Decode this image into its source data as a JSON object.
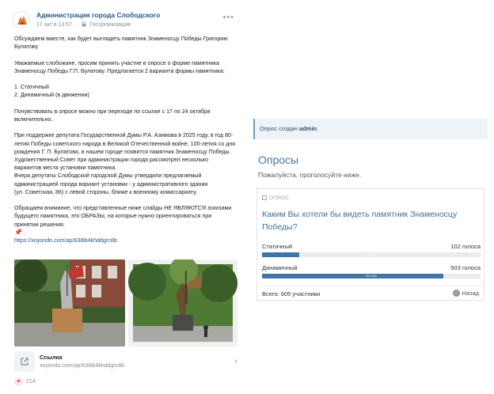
{
  "post": {
    "author": "Администрация города Слободского",
    "date": "17 окт в 13:57",
    "audience": "Госорганизация",
    "paragraphs": [
      "Обсуждаем вместе, как будет выглядеть памятник Знаменосцу Победы Григорию Булатову",
      "Уважаемые слобожане, просим принять участие в опросе о форме памятника Знаменосцу Победы Г.П. Булатову. Предлагается 2 варианта формы памятника:",
      "1. Статичный",
      "2. Динамичный (в движении)",
      "Почувствовать в опросе можно при переходе по ссылке с 17 по 24 октября включительно.",
      "При поддержке депутата Государственной Думы Р.А. Азимова в 2025 году, в год 80-летия Победы советского народа в Великой Отечественной войне, 100-летия со дня рождения Г. П. Булатова, в нашем городе появится памятник Знаменосцу Победы.",
      "Художественный Совет при администрации города рассмотрел несколько вариантов места установки памятника.",
      "Вчера депутаты Слободской городской Думы утвердили предлагаемый администрацией города вариант установки - у административного здания",
      "(ул. Советская, 86) с левой стороны, ближе к военному комиссариату.",
      "Обращаем внимание, что представленные ниже слайды НЕ ЯВЛЯЮТСЯ эскизами будущего памятника, это ОБРАЗЫ, на которые нужно ориентироваться при принятии решения.",
      "https://xoyondo.com/ap/638ib4khddgrc8b"
    ],
    "link_card": {
      "title": "Ссылка",
      "url": "xoyondo.com/ap/638ib4khddgrc8b"
    },
    "likes": "214"
  },
  "poll": {
    "notice_prefix": "Опрос создан ",
    "notice_author": "admin",
    "notice_suffix": ".",
    "heading": "Опросы",
    "subheading": "Пожалуйста, проголосуйте ниже.",
    "label": "ОПРОС",
    "question": "Каким Вы хотели бы видеть памятник Знаменосцу Победы?",
    "options": [
      {
        "name": "Статичный",
        "votes": "102 голоса",
        "percent_label": "16.86%",
        "fraction": 0.1686
      },
      {
        "name": "Динамичный",
        "votes": "503 голоса",
        "percent_label": "83.14%",
        "fraction": 0.8314
      }
    ],
    "total": "Всего: 605 участники",
    "back_label": "Назад"
  },
  "colors": {
    "link": "#2a5885",
    "poll_bar": "#3f75a8",
    "poll_heading": "#4a78a6"
  }
}
